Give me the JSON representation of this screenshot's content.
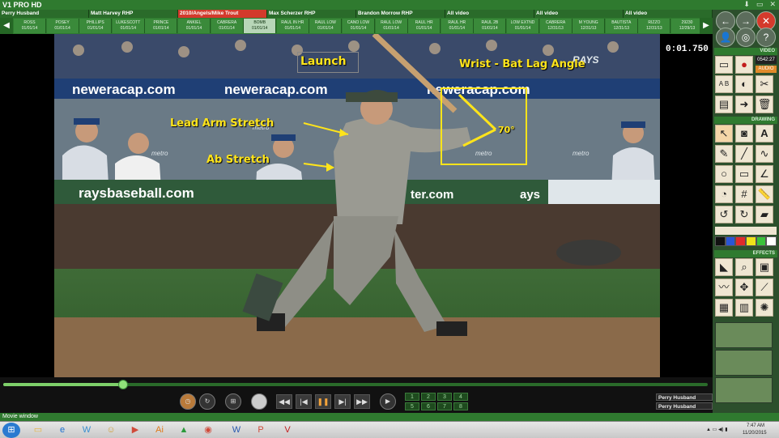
{
  "app": {
    "title": "V1 PRO HD"
  },
  "player_tabs": [
    {
      "label": "Perry Husband",
      "color": "green"
    },
    {
      "label": "Matt Harvey RHP",
      "color": "green"
    },
    {
      "label": "2010/Angels/Mike Trout",
      "color": "red"
    },
    {
      "label": "Max Scherzer RHP",
      "color": "green"
    },
    {
      "label": "Brandon Morrow RHP",
      "color": "green"
    },
    {
      "label": "All video",
      "color": "green"
    },
    {
      "label": "All video",
      "color": "green"
    },
    {
      "label": "All video",
      "color": "green"
    }
  ],
  "clips": [
    {
      "name": "ROSS",
      "date": "01/01/14"
    },
    {
      "name": "POSEY",
      "date": "01/01/14"
    },
    {
      "name": "PHILLIPS",
      "date": "01/01/14"
    },
    {
      "name": "LUKESCOTT",
      "date": "01/01/14"
    },
    {
      "name": "PRINCE",
      "date": "01/01/14"
    },
    {
      "name": "ANKIEL",
      "date": "01/01/14"
    },
    {
      "name": "CABRERA",
      "date": "01/01/14"
    },
    {
      "name": "BOMB",
      "date": "01/01/14"
    },
    {
      "name": "RAUL IN HR",
      "date": "01/01/14"
    },
    {
      "name": "RAUL LOW",
      "date": "01/01/14"
    },
    {
      "name": "CANO LOW",
      "date": "01/01/14"
    },
    {
      "name": "RAUL LOW",
      "date": "01/01/14"
    },
    {
      "name": "RAUL HR",
      "date": "01/01/14"
    },
    {
      "name": "RAUL HR",
      "date": "01/01/14"
    },
    {
      "name": "RAUL 2B",
      "date": "01/01/14"
    },
    {
      "name": "LOW EXTND",
      "date": "01/01/14"
    },
    {
      "name": "CABRERA",
      "date": "12/31/13"
    },
    {
      "name": "M YOUNG",
      "date": "12/31/13"
    },
    {
      "name": "BAUTISTA",
      "date": "12/31/13"
    },
    {
      "name": "RIZZO",
      "date": "12/31/13"
    },
    {
      "name": "29230",
      "date": "12/29/13"
    }
  ],
  "active_clip_index": 7,
  "video": {
    "timer": "0:01.750",
    "annotations": {
      "launch": "Launch",
      "wrist": "Wrist - Bat Lag Angle",
      "lead_arm": "Lead Arm Stretch",
      "ab": "Ab Stretch",
      "angle": "70°"
    },
    "banners": {
      "newera_left": "neweracap.com",
      "newera_right": "neweracap.com",
      "rays": "raysbaseball.com",
      "ter": "ter.com",
      "ays": "ays",
      "metro": "metro",
      "rays_logo": "RAYS"
    }
  },
  "right_panel": {
    "video_header": "VIDEO",
    "counter": "0542:27",
    "audio": "AUDIO",
    "drawing_header": "DRAWING",
    "effects_header": "EFFECTS",
    "ab_label": "A B"
  },
  "scrubber": {
    "progress": 0.17
  },
  "pad_numbers": [
    "1",
    "2",
    "3",
    "4",
    "5",
    "6",
    "7",
    "8"
  ],
  "playback_players": [
    "Perry Husband",
    "Perry Husband"
  ],
  "status": "Movie window",
  "tray": {
    "time": "7:47 AM",
    "date": "11/20/2015"
  },
  "colors": {
    "palette": [
      "#111111",
      "#2a56d6",
      "#e02b2b",
      "#f0e21a",
      "#3ac23a",
      "#ffffff"
    ],
    "annotation": "#ffe41a",
    "ui_green": "#2f7a2f"
  },
  "icons": {
    "prev": "chevron-left-icon",
    "next": "chevron-right-icon"
  }
}
